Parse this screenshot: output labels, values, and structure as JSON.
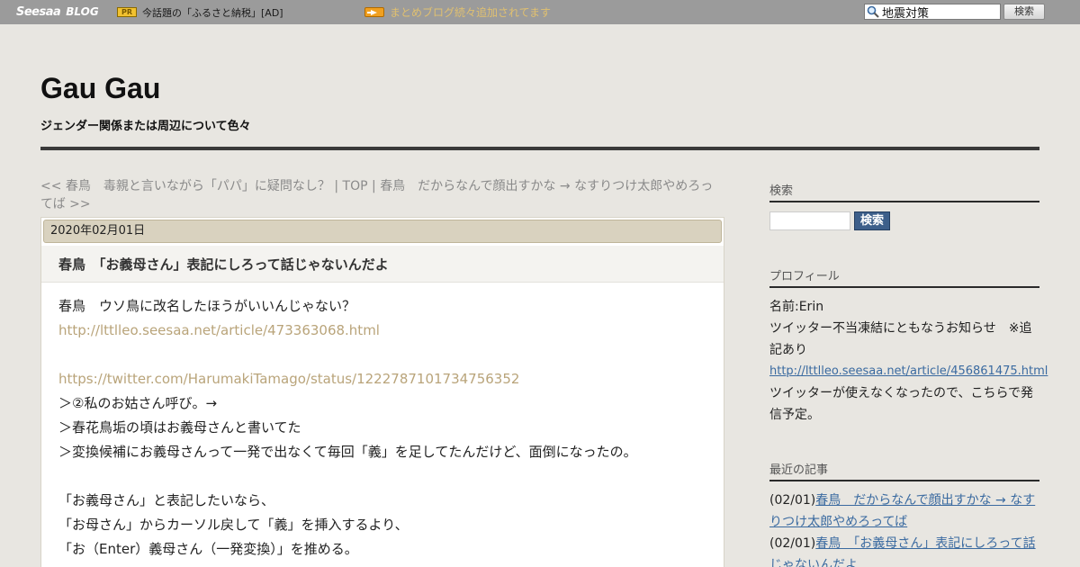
{
  "topbar": {
    "logo_seesaa": "Seesaa",
    "logo_blog": "BLOG",
    "pr_badge": "PR",
    "pr_text": "今話題の「ふるさと納税」[AD]",
    "news_text": "まとめブログ続々追加されてます",
    "search_value": "地震対策",
    "search_button": "検索"
  },
  "header": {
    "title": "Gau Gau",
    "description": "ジェンダー関係または周辺について色々"
  },
  "nav": {
    "prev": "<< 春鳥　毒親と言いながら「パパ」に疑問なし？",
    "sep1": " | ",
    "top": "TOP",
    "sep2": " | ",
    "next": "春鳥　だからなんで顔出すかな → なすりつけ太郎やめろってば >>"
  },
  "entry": {
    "date": "2020年02月01日",
    "title": "春鳥　「お義母さん」表記にしろって話じゃないんだよ",
    "lines": [
      "春鳥　ウソ鳥に改名したほうがいいんじゃない？",
      "http://lttlleo.seesaa.net/article/473363068.html",
      "",
      "https://twitter.com/HarumakiTamago/status/1222787101734756352",
      "＞②私のお姑さん呼び。→",
      "＞春花鳥垢の頃はお義母さんと書いてた",
      "＞変換候補にお義母さんって一発で出なくて毎回「義」を足してたんだけど、面倒になったの。",
      "",
      "「お義母さん」と表記したいなら、",
      "「お母さん」からカーソル戻して「義」を挿入するより、",
      "「お（Enter）義母さん（一発変換）」を推める。"
    ]
  },
  "sidebar": {
    "search_heading": "検索",
    "search_button": "検索",
    "profile_heading": "プロフィール",
    "profile_name": "名前:Erin",
    "profile_text1": "ツイッター不当凍結にともなうお知らせ　※追記あり",
    "profile_link": "http://lttlleo.seesaa.net/article/456861475.html",
    "profile_text2": "ツイッターが使えなくなったので、こちらで発信予定。",
    "recent_heading": "最近の記事",
    "recent": [
      {
        "date": "(02/01)",
        "title": "春鳥　だからなんで顔出すかな → なすりつけ太郎やめろってば"
      },
      {
        "date": "(02/01)",
        "title": "春鳥　「お義母さん」表記にしろって話じゃないんだよ"
      }
    ]
  }
}
